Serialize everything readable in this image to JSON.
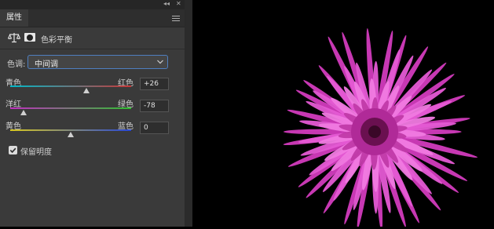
{
  "panel": {
    "tab_label": "属性",
    "title": "色彩平衡",
    "collapse_glyph": "◂◂",
    "close_glyph": "✕"
  },
  "tone": {
    "label": "色调:",
    "value": "中间调"
  },
  "sliders": [
    {
      "left_label": "青色",
      "right_label": "红色",
      "value": "+26",
      "level_fraction": 0.63,
      "gradient": [
        "#00b8c8",
        "#c83838"
      ]
    },
    {
      "left_label": "洋红",
      "right_label": "绿色",
      "value": "-78",
      "level_fraction": 0.11,
      "gradient": [
        "#c030c0",
        "#30c030"
      ]
    },
    {
      "left_label": "黄色",
      "right_label": "蓝色",
      "value": "0",
      "level_fraction": 0.5,
      "gradient": [
        "#d8c820",
        "#2848d8"
      ]
    }
  ],
  "preserve_luminosity": {
    "label": "保留明度",
    "checked": true
  },
  "colors": {
    "panel_bg": "#3a3a3a",
    "focus_border": "#4f7fc0",
    "flower_magenta": "#e040c8",
    "flower_center": "#6a1050"
  },
  "icons": [
    "balance-icon",
    "mask-icon",
    "chevron-down-icon",
    "panel-menu-icon",
    "check-icon"
  ]
}
